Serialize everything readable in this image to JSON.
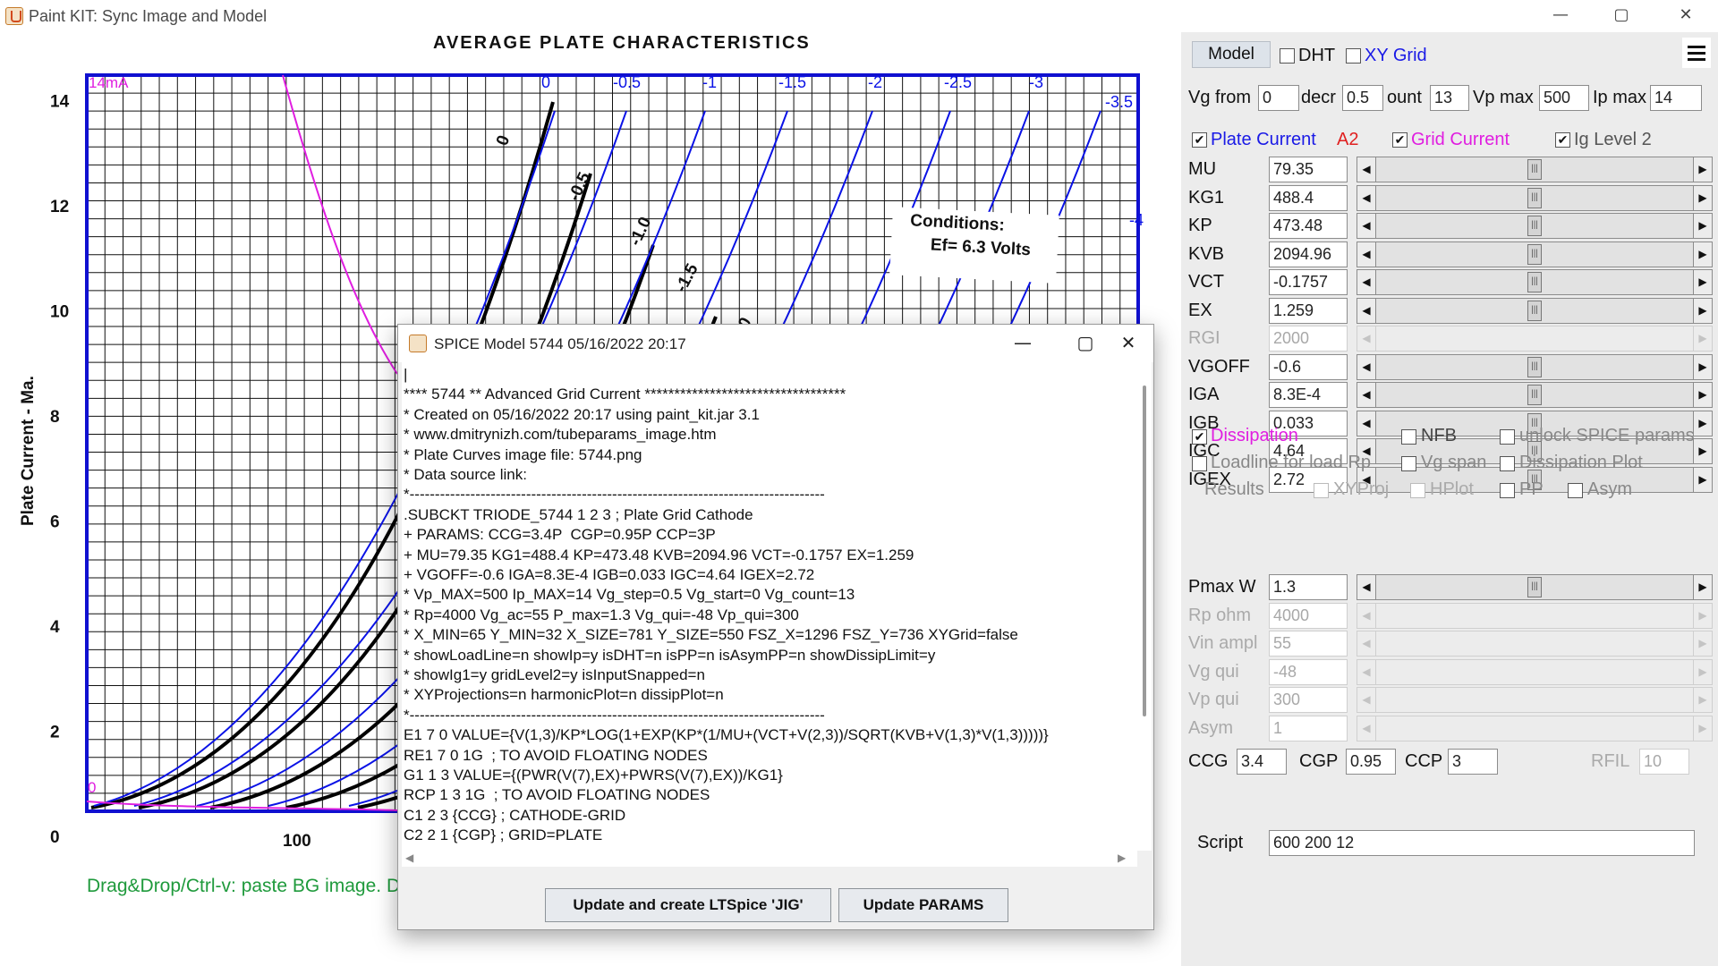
{
  "window": {
    "title": "Paint KIT: Sync Image and Model",
    "minimize": "—",
    "maximize": "▢",
    "close": "✕"
  },
  "plot": {
    "image_title": "AVERAGE  PLATE  CHARACTERISTICS",
    "y_axis_label": "Plate Current - Ma.",
    "y_ticks": [
      "0",
      "2",
      "4",
      "6",
      "8",
      "10",
      "12",
      "14"
    ],
    "x_ticks": [
      "100"
    ],
    "overlay_labels": {
      "imax": "14mA",
      "origin": "0"
    },
    "grid_voltage_labels": [
      "0",
      "-0.5",
      "-1",
      "-1.5",
      "-2",
      "-2.5",
      "-3",
      "-3.5",
      "-4"
    ],
    "image_curve_labels": [
      "0",
      "-0.5",
      "-1.0",
      "-1.5",
      "-2.0"
    ],
    "conditions": [
      "Conditions:",
      "Ef= 6.3 Volts"
    ],
    "drag_hint": "Drag&Drop/Ctrl-v: paste BG image. D",
    "colors": {
      "model_curves": "#0a12e6",
      "grid_current": "#e01ee0",
      "image_curves": "#000000",
      "grid_border": "#1010d0",
      "hint": "#1f9a3c"
    }
  },
  "panel": {
    "model_button": "Model",
    "dht": {
      "label": "DHT",
      "checked": false
    },
    "xy_grid": {
      "label": "XY Grid",
      "checked": false
    },
    "menu_icon": "hamburger-menu",
    "vg_from": {
      "label": "Vg from",
      "value": "0"
    },
    "decr": {
      "label": "decr",
      "value": "0.5"
    },
    "count": {
      "label": "ount",
      "value": "13"
    },
    "vp_max": {
      "label": "Vp max",
      "value": "500"
    },
    "ip_max": {
      "label": "Ip max",
      "value": "14"
    },
    "plate_current": {
      "label": "Plate Current",
      "checked": true,
      "color": "#1a1ae6"
    },
    "a2": {
      "label": "A2",
      "color": "#e02020"
    },
    "grid_current": {
      "label": "Grid Current",
      "checked": true,
      "color": "#e01ee0"
    },
    "ig_level2": {
      "label": "Ig Level 2",
      "checked": true
    },
    "params": [
      {
        "label": "MU",
        "value": "79.35",
        "enabled": true,
        "pos": 0.5
      },
      {
        "label": "KG1",
        "value": "488.4",
        "enabled": true,
        "pos": 0.5
      },
      {
        "label": "KP",
        "value": "473.48",
        "enabled": true,
        "pos": 0.5
      },
      {
        "label": "KVB",
        "value": "2094.96",
        "enabled": true,
        "pos": 0.5
      },
      {
        "label": "VCT",
        "value": "-0.1757",
        "enabled": true,
        "pos": 0.5
      },
      {
        "label": "EX",
        "value": "1.259",
        "enabled": true,
        "pos": 0.5
      },
      {
        "label": "RGI",
        "value": "2000",
        "enabled": false,
        "pos": 0.5
      },
      {
        "label": "VGOFF",
        "value": "-0.6",
        "enabled": true,
        "pos": 0.5
      },
      {
        "label": "IGA",
        "value": "8.3E-4",
        "enabled": true,
        "pos": 0.5
      },
      {
        "label": "IGB",
        "value": "0.033",
        "enabled": true,
        "pos": 0.5
      },
      {
        "label": "IGC",
        "value": "4.64",
        "enabled": true,
        "pos": 0.5
      },
      {
        "label": "IGEX",
        "value": "2.72",
        "enabled": true,
        "pos": 0.5
      }
    ],
    "dissipation": {
      "label": "Dissipation",
      "checked": true,
      "color": "#e01ee0"
    },
    "nfb": {
      "label": "NFB",
      "checked": false
    },
    "unlock": {
      "label": "unlock SPICE params",
      "checked": false
    },
    "loadline": {
      "label": "Loadline for load Rp",
      "checked": false
    },
    "vg_span": {
      "label": "Vg span",
      "checked": false
    },
    "dissip_plot": {
      "label": "Dissipation Plot",
      "checked": false
    },
    "results": {
      "label": "Results"
    },
    "xyproj": {
      "label": "XYProj",
      "checked": false
    },
    "hplot": {
      "label": "HPlot",
      "checked": false
    },
    "pp": {
      "label": "PP",
      "checked": false
    },
    "asym_cb": {
      "label": "Asym",
      "checked": false
    },
    "lower_params": [
      {
        "label": "Pmax W",
        "value": "1.3",
        "enabled": true,
        "pos": 0.5
      },
      {
        "label": "Rp ohm",
        "value": "4000",
        "enabled": false
      },
      {
        "label": "Vin ampl",
        "value": "55",
        "enabled": false
      },
      {
        "label": "Vg qui",
        "value": "-48",
        "enabled": false
      },
      {
        "label": "Vp qui",
        "value": "300",
        "enabled": false
      },
      {
        "label": "Asym",
        "value": "1",
        "enabled": false
      }
    ],
    "ccg": {
      "label": "CCG",
      "value": "3.4"
    },
    "cgp": {
      "label": "CGP",
      "value": "0.95"
    },
    "ccp": {
      "label": "CCP",
      "value": "3"
    },
    "rfil": {
      "label": "RFIL",
      "value": "10"
    },
    "script": {
      "label": "Script",
      "value": "600 200 12"
    }
  },
  "dialog": {
    "title": "SPICE Model 5744 05/16/2022 20:17",
    "lines": [
      "|",
      "**** 5744 ** Advanced Grid Current **********************************",
      "* Created on 05/16/2022 20:17 using paint_kit.jar 3.1",
      "* www.dmitrynizh.com/tubeparams_image.htm",
      "* Plate Curves image file: 5744.png",
      "* Data source link:",
      "*----------------------------------------------------------------------------------",
      ".SUBCKT TRIODE_5744 1 2 3 ; Plate Grid Cathode",
      "+ PARAMS: CCG=3.4P  CGP=0.95P CCP=3P",
      "+ MU=79.35 KG1=488.4 KP=473.48 KVB=2094.96 VCT=-0.1757 EX=1.259",
      "+ VGOFF=-0.6 IGA=8.3E-4 IGB=0.033 IGC=4.64 IGEX=2.72",
      "* Vp_MAX=500 Ip_MAX=14 Vg_step=0.5 Vg_start=0 Vg_count=13",
      "* Rp=4000 Vg_ac=55 P_max=1.3 Vg_qui=-48 Vp_qui=300",
      "* X_MIN=65 Y_MIN=32 X_SIZE=781 Y_SIZE=550 FSZ_X=1296 FSZ_Y=736 XYGrid=false",
      "* showLoadLine=n showIp=y isDHT=n isPP=n isAsymPP=n showDissipLimit=y",
      "* showIg1=y gridLevel2=y isInputSnapped=n",
      "* XYProjections=n harmonicPlot=n dissipPlot=n",
      "*----------------------------------------------------------------------------------",
      "E1 7 0 VALUE={V(1,3)/KP*LOG(1+EXP(KP*(1/MU+(VCT+V(2,3))/SQRT(KVB+V(1,3)*V(1,3)))))}",
      "RE1 7 0 1G  ; TO AVOID FLOATING NODES",
      "G1 1 3 VALUE={(PWR(V(7),EX)+PWRS(V(7),EX))/KG1}",
      "RCP 1 3 1G  ; TO AVOID FLOATING NODES",
      "C1 2 3 {CCG} ; CATHODE-GRID",
      "C2 2 1 {CGP} ; GRID=PLATE"
    ],
    "btn_update_ltspice": "Update and create LTSpice 'JIG'",
    "btn_update_params": "Update PARAMS"
  }
}
